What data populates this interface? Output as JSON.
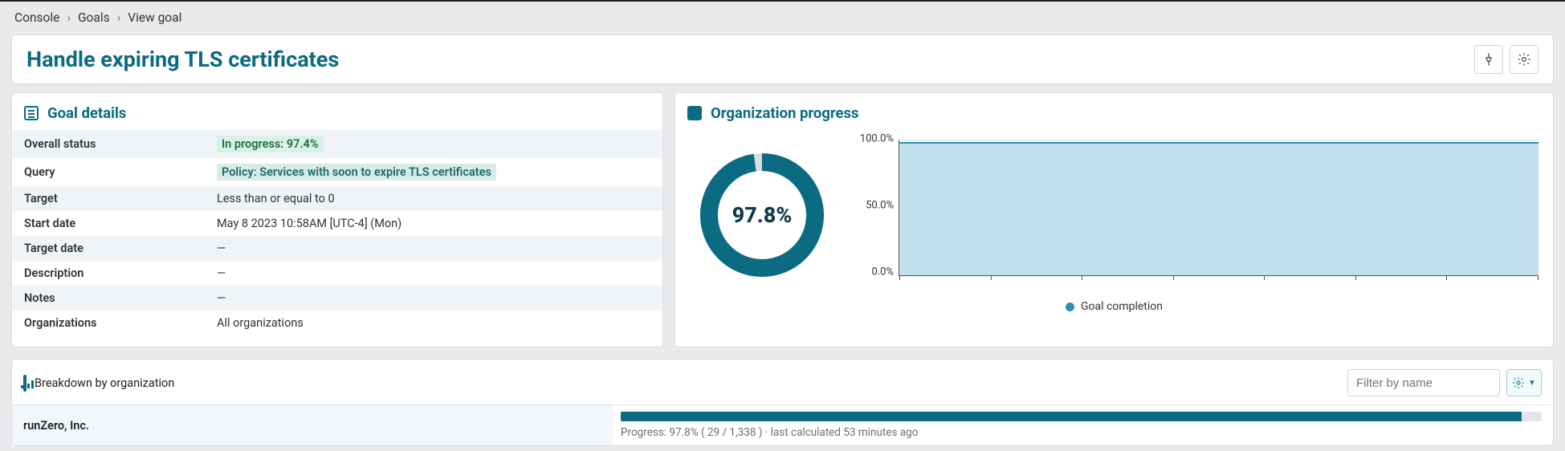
{
  "breadcrumbs": {
    "a": "Console",
    "b": "Goals",
    "c": "View goal"
  },
  "title": "Handle expiring TLS certificates",
  "details": {
    "header": "Goal details",
    "rows": {
      "overall_status_k": "Overall status",
      "overall_status_v": "In progress: 97.4%",
      "query_k": "Query",
      "query_v": "Policy: Services with soon to expire TLS certificates",
      "target_k": "Target",
      "target_v": "Less than or equal to 0",
      "start_k": "Start date",
      "start_v": "May 8 2023 10:58AM [UTC-4] (Mon)",
      "tdate_k": "Target date",
      "tdate_v": "—",
      "desc_k": "Description",
      "desc_v": "—",
      "notes_k": "Notes",
      "notes_v": "—",
      "orgs_k": "Organizations",
      "orgs_v": "All organizations"
    }
  },
  "progress": {
    "header": "Organization progress",
    "donut_label": "97.8%",
    "legend": "Goal completion",
    "y_top": "100.0%",
    "y_mid": "50.0%",
    "y_bot": "0.0%"
  },
  "breakdown": {
    "header": "Breakdown by organization",
    "filter_placeholder": "Filter by name",
    "org0": {
      "name": "runZero, Inc.",
      "bar_pct": 97.8,
      "text": "Progress: 97.8% ( 29 / 1,338 ) · last calculated 53 minutes ago"
    }
  },
  "chart_data": {
    "type": "area",
    "title": "Organization progress",
    "ylabel": "Goal completion",
    "ylim": [
      0,
      100
    ],
    "y_ticks": [
      0,
      50,
      100
    ],
    "series": [
      {
        "name": "Goal completion",
        "values": [
          98,
          98,
          98,
          98,
          98,
          98,
          98,
          98
        ]
      }
    ],
    "donut": {
      "value": 97.8,
      "max": 100,
      "label": "97.8%"
    }
  }
}
